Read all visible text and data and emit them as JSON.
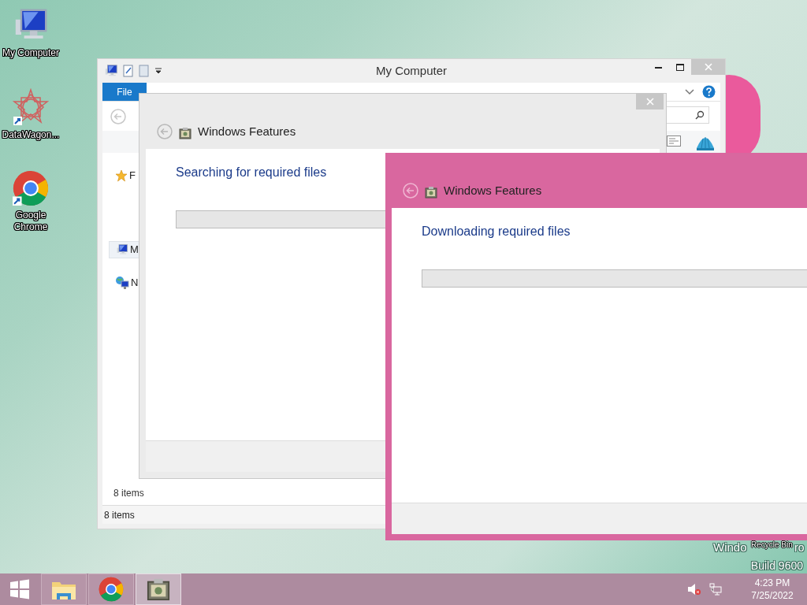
{
  "desktop_icons": [
    {
      "label": "My Computer",
      "kind": "computer"
    },
    {
      "label": "DataWagon...",
      "kind": "star"
    },
    {
      "label": "Google Chrome",
      "kind": "chrome"
    }
  ],
  "explorer": {
    "title": "My Computer",
    "ribbon_tabs": [
      {
        "label": "File",
        "selected": true
      }
    ],
    "nav_items": [
      {
        "label": "F",
        "kind": "star",
        "selected": false
      },
      {
        "label": "M",
        "kind": "computer",
        "selected": true
      },
      {
        "label": "N",
        "kind": "network",
        "selected": false
      }
    ],
    "item_count": "8 items",
    "status_bar": "8 items"
  },
  "dialogs": [
    {
      "title": "Windows Features",
      "message": "Searching for required files",
      "progress_bar": true,
      "active": false
    },
    {
      "title": "Windows Features",
      "message": "Downloading required files",
      "progress_bar": true,
      "active": true
    }
  ],
  "os_version": {
    "line_1_start": "Windo",
    "line_1_end": "ro",
    "line_2": "Build 9600"
  },
  "recycle_bin_label": "Recycle Bin",
  "taskbar": {
    "apps": [
      {
        "kind": "explorer",
        "active": false
      },
      {
        "kind": "chrome",
        "active": false
      },
      {
        "kind": "features",
        "active": true
      }
    ],
    "clock": {
      "time": "4:23 PM",
      "date": "7/25/2022"
    }
  }
}
